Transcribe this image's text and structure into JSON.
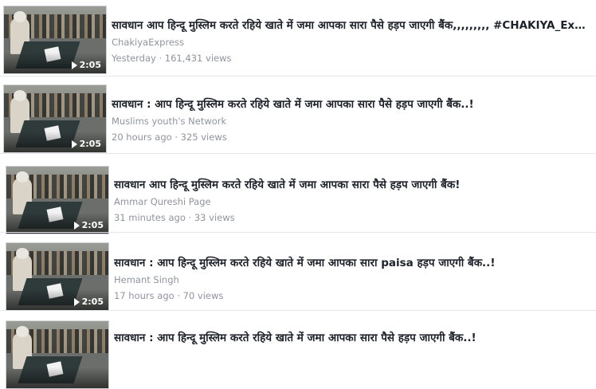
{
  "videos": [
    {
      "title": "सावधान आप हिन्दू मुस्लिम करते रहिये खाते में जमा आपका सारा पैसे हड़प जाएगी बैंक,,,,,,,,, #CHAKIYA_Express",
      "channel": "ChakiyaExpress",
      "time": "Yesterday",
      "views": "161,431 views",
      "duration": "2:05"
    },
    {
      "title": "सावधान : आप हिन्दू मुस्लिम करते रहिये खाते में जमा आपका सारा पैसे हड़प जाएगी बैंक..!",
      "channel": "Muslims youth's Network",
      "time": "20 hours ago",
      "views": "325 views",
      "duration": "2:05"
    },
    {
      "title": "सावधान आप हिन्दू मुस्लिम करते रहिये खाते में जमा आपका सारा पैसे हड़प जाएगी बैंक!",
      "channel": "Ammar Qureshi Page",
      "time": "31 minutes ago",
      "views": "33 views",
      "duration": "2:05"
    },
    {
      "title": "सावधान : आप हिन्दू मुस्लिम करते रहिये खाते में जमा आपका सारा paisa हड़प जाएगी बैंक..!",
      "channel": "Hemant Singh",
      "time": "17 hours ago",
      "views": "70 views",
      "duration": "2:05"
    },
    {
      "title": "सावधान : आप हिन्दू मुस्लिम करते रहिये खाते में जमा आपका सारा पैसे हड़प जाएगी बैंक..!",
      "channel": "",
      "time": "",
      "views": "",
      "duration": ""
    }
  ],
  "separator": " · "
}
